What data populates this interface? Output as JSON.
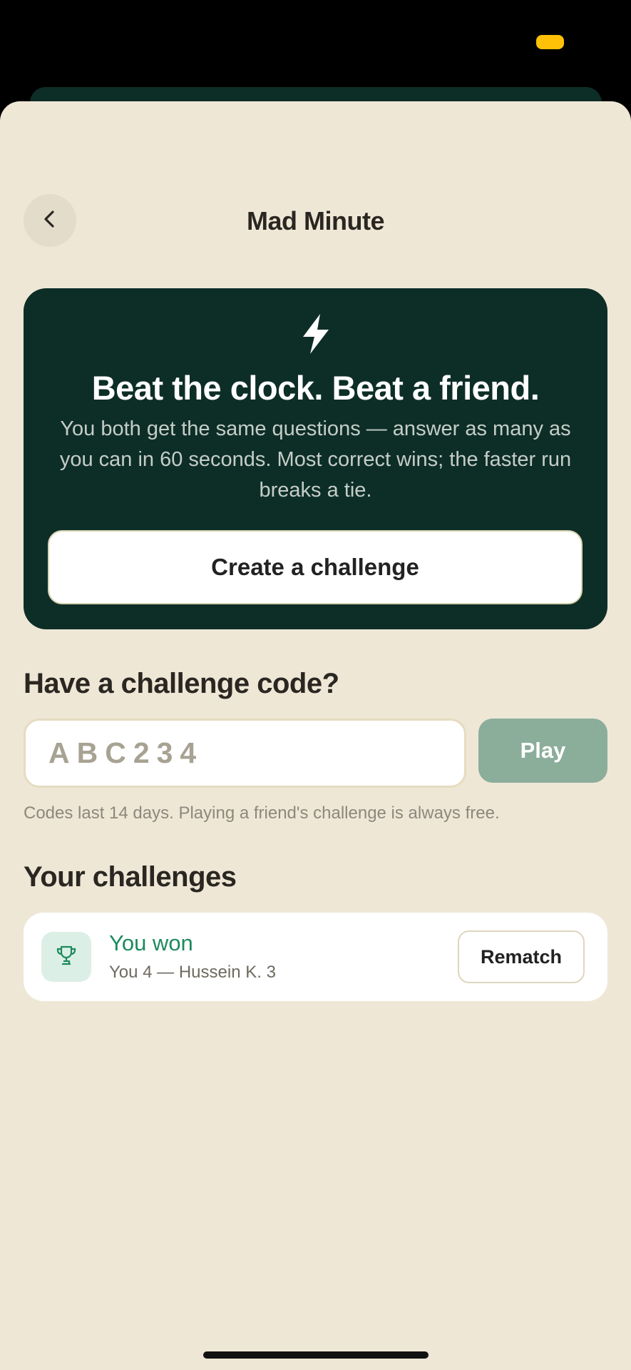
{
  "header": {
    "title": "Mad Minute",
    "back_icon": "chevron-left-icon"
  },
  "hero": {
    "icon": "lightning-bolt-icon",
    "title": "Beat the clock. Beat a friend.",
    "description": "You both get the same questions — answer as many as you can in 60 seconds. Most correct wins; the faster run breaks a tie.",
    "create_button_label": "Create a challenge"
  },
  "code_section": {
    "heading": "Have a challenge code?",
    "input_value": "",
    "input_placeholder": "ABC234",
    "play_button_label": "Play",
    "hint": "Codes last 14 days. Playing a friend's challenge is always free."
  },
  "challenges": {
    "heading": "Your challenges",
    "items": [
      {
        "icon": "trophy-icon",
        "result": "You won",
        "score": "You 4 — Hussein K. 3",
        "action_label": "Rematch"
      }
    ]
  },
  "colors": {
    "sheet_background": "#EFE7D6",
    "hero_background": "#0D2E27",
    "play_button": "#8BAE9B",
    "win_green": "#1E8A5E",
    "status_indicator": "#FFC107"
  }
}
